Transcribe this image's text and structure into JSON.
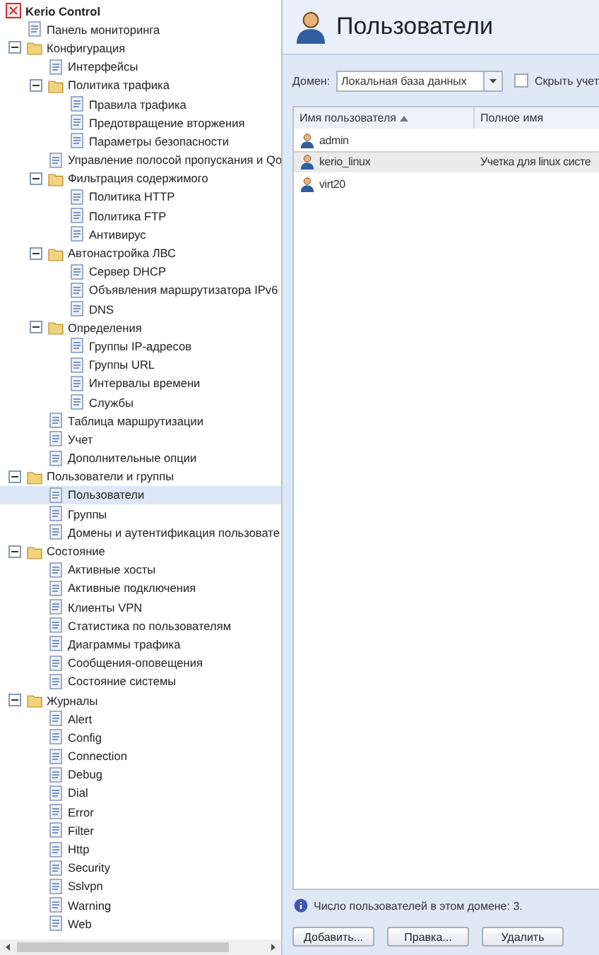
{
  "tree": [
    {
      "label": "Kerio Control",
      "kind": "root",
      "selected": false,
      "children": [
        {
          "label": "Панель мониторинга",
          "selected": false
        },
        {
          "label": "Конфигурация",
          "selected": false,
          "expanded": true,
          "children": [
            {
              "label": "Интерфейсы",
              "selected": false
            },
            {
              "label": "Политика трафика",
              "selected": false,
              "expanded": true,
              "children": [
                {
                  "label": "Правила трафика",
                  "selected": false
                },
                {
                  "label": "Предотвращение вторжения",
                  "selected": false
                },
                {
                  "label": "Параметры безопасности",
                  "selected": false
                }
              ]
            },
            {
              "label": "Управление полосой пропускания и Qo",
              "selected": false
            },
            {
              "label": "Фильтрация содержимого",
              "selected": false,
              "expanded": true,
              "children": [
                {
                  "label": "Политика HTTP",
                  "selected": false
                },
                {
                  "label": "Политика FTP",
                  "selected": false
                },
                {
                  "label": "Антивирус",
                  "selected": false
                }
              ]
            },
            {
              "label": "Автонастройка ЛВС",
              "selected": false,
              "expanded": true,
              "children": [
                {
                  "label": "Сервер DHCP",
                  "selected": false
                },
                {
                  "label": "Объявления маршрутизатора IPv6",
                  "selected": false
                },
                {
                  "label": "DNS",
                  "selected": false
                }
              ]
            },
            {
              "label": "Определения",
              "selected": false,
              "expanded": true,
              "children": [
                {
                  "label": "Группы IP-адресов",
                  "selected": false
                },
                {
                  "label": "Группы URL",
                  "selected": false
                },
                {
                  "label": "Интервалы времени",
                  "selected": false
                },
                {
                  "label": "Службы",
                  "selected": false
                }
              ]
            },
            {
              "label": "Таблица маршрутизации",
              "selected": false
            },
            {
              "label": "Учет",
              "selected": false
            },
            {
              "label": "Дополнительные опции",
              "selected": false
            }
          ]
        },
        {
          "label": "Пользователи и группы",
          "selected": false,
          "expanded": true,
          "children": [
            {
              "label": "Пользователи",
              "selected": true
            },
            {
              "label": "Группы",
              "selected": false
            },
            {
              "label": "Домены и аутентификация пользовате",
              "selected": false
            }
          ]
        },
        {
          "label": "Состояние",
          "selected": false,
          "expanded": true,
          "children": [
            {
              "label": "Активные хосты",
              "selected": false
            },
            {
              "label": "Активные подключения",
              "selected": false
            },
            {
              "label": "Клиенты VPN",
              "selected": false
            },
            {
              "label": "Статистика по пользователям",
              "selected": false
            },
            {
              "label": "Диаграммы трафика",
              "selected": false
            },
            {
              "label": "Сообщения-оповещения",
              "selected": false
            },
            {
              "label": "Состояние системы",
              "selected": false
            }
          ]
        },
        {
          "label": "Журналы",
          "selected": false,
          "expanded": true,
          "children": [
            {
              "label": "Alert",
              "selected": false
            },
            {
              "label": "Config",
              "selected": false
            },
            {
              "label": "Connection",
              "selected": false
            },
            {
              "label": "Debug",
              "selected": false
            },
            {
              "label": "Dial",
              "selected": false
            },
            {
              "label": "Error",
              "selected": false
            },
            {
              "label": "Filter",
              "selected": false
            },
            {
              "label": "Http",
              "selected": false
            },
            {
              "label": "Security",
              "selected": false
            },
            {
              "label": "Sslvpn",
              "selected": false
            },
            {
              "label": "Warning",
              "selected": false
            },
            {
              "label": "Web",
              "selected": false
            }
          ]
        }
      ]
    }
  ],
  "page": {
    "title": "Пользователи"
  },
  "domain": {
    "label": "Домен:",
    "value": "Локальная база данных"
  },
  "hide_checkbox": {
    "label": "Скрыть учет",
    "checked": false
  },
  "table": {
    "columns": [
      {
        "label": "Имя пользователя",
        "sorted": true
      },
      {
        "label": "Полное имя",
        "sorted": false
      }
    ],
    "rows": [
      {
        "cells": [
          "admin",
          ""
        ],
        "selected": false
      },
      {
        "cells": [
          "kerio_linux",
          "Учетка для linux систе"
        ],
        "selected": true
      },
      {
        "cells": [
          "virt20",
          ""
        ],
        "selected": false
      }
    ]
  },
  "info": "Число пользователей в этом домене: 3.",
  "buttons": [
    "Добавить...",
    "Правка...",
    "Удалить"
  ]
}
